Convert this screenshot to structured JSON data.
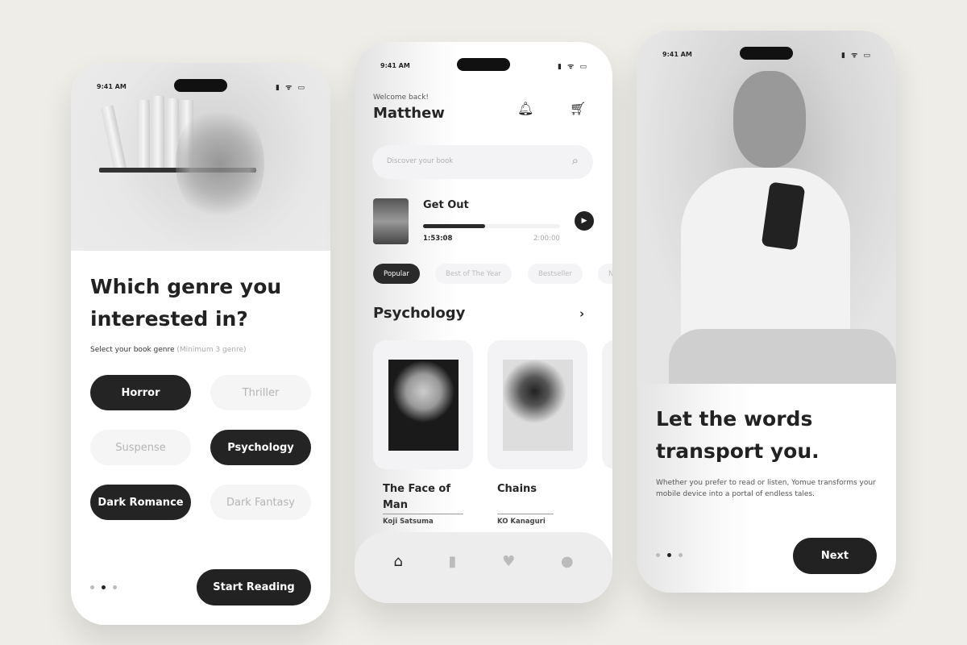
{
  "status": {
    "time": "9:41 AM",
    "icons": "signal wifi battery"
  },
  "screen1": {
    "title": "Which genre you interested in?",
    "subtitle": "Select your book genre",
    "subtitle_hint": "(Minimum 3 genre)",
    "genres": [
      {
        "label": "Horror",
        "selected": true
      },
      {
        "label": "Thriller",
        "selected": false
      },
      {
        "label": "Suspense",
        "selected": false
      },
      {
        "label": "Psychology",
        "selected": true
      },
      {
        "label": "Dark Romance",
        "selected": true
      },
      {
        "label": "Dark Fantasy",
        "selected": false
      }
    ],
    "page_index": 2,
    "page_count": 3,
    "cta": "Start Reading"
  },
  "screen2": {
    "welcome": "Welcome back!",
    "user": "Matthew",
    "icons": [
      "bell-icon",
      "cart-icon"
    ],
    "search_placeholder": "Discover your book",
    "now_playing": {
      "title": "Get Out",
      "elapsed": "1:53:08",
      "total": "2:00:00",
      "progress": 0.45
    },
    "tabs": [
      "Popular",
      "Best of The Year",
      "Bestseller",
      "N"
    ],
    "active_tab": "Popular",
    "section": "Psychology",
    "books": [
      {
        "title": "The Face of Man",
        "author": "Koji Satsuma"
      },
      {
        "title": "Chains",
        "author": "KO Kanaguri"
      }
    ],
    "nav": [
      "home",
      "book",
      "heart",
      "profile"
    ]
  },
  "screen3": {
    "title": "Let the words transport you.",
    "description": "Whether you prefer to read or listen, Yomue transforms your mobile device into a portal of endless tales.",
    "page_index": 2,
    "page_count": 3,
    "cta": "Next"
  }
}
